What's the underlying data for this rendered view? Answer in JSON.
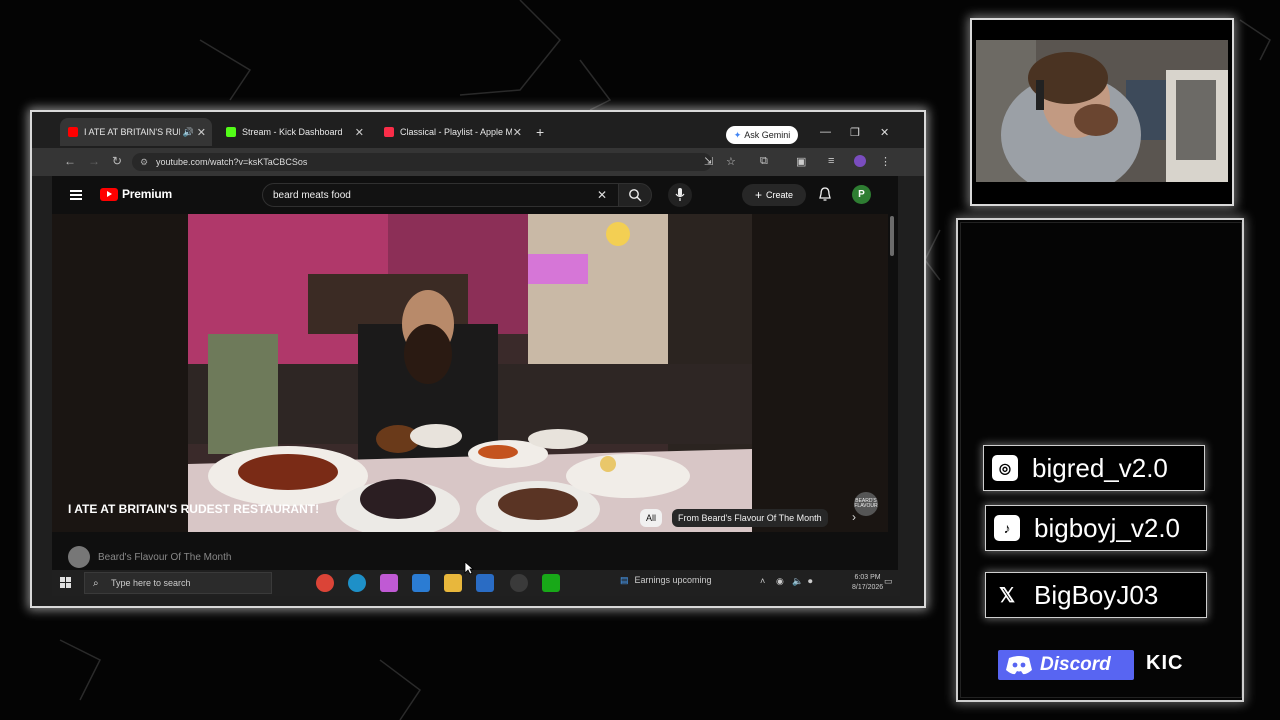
{
  "browser": {
    "tabs": [
      {
        "label": "I ATE AT BRITAIN'S RUDEST",
        "favicon_color": "#ff0000",
        "active": true
      },
      {
        "label": "Stream - Kick Dashboard",
        "favicon_color": "#53fc18",
        "active": false
      },
      {
        "label": "Classical - Playlist - Apple Musi",
        "favicon_color": "#fa2d48",
        "active": false
      }
    ],
    "new_tab": "+",
    "gemini_label": "Ask Gemini",
    "url": "youtube.com/watch?v=ksKTaCBCSos"
  },
  "youtube": {
    "logo_text": "Premium",
    "search_value": "beard meats food",
    "create_label": "Create",
    "avatar_letter": "P",
    "video_title": "I ATE AT BRITAIN'S RUDEST RESTAURANT!",
    "channel_name": "Beard's Flavour Of The Month",
    "watermark": "BEARD'S FLAVOUR",
    "chips": [
      "All",
      "From Beard's Flavour Of The Month"
    ]
  },
  "taskbar": {
    "search_placeholder": "Type here to search",
    "weather": "Earnings upcoming",
    "time": "6:03 PM",
    "date": "8/17/2026"
  },
  "socials": {
    "instagram": "bigred_v2.0",
    "tiktok": "bigboyj_v2.0",
    "x": "BigBoyJ03",
    "discord": "Discord",
    "kick": "KIC"
  },
  "colors": {
    "youtube_red": "#ff0000",
    "kick_green": "#53fc18",
    "discord_blurple": "#5865f2",
    "avatar_green": "#2e7d32"
  }
}
